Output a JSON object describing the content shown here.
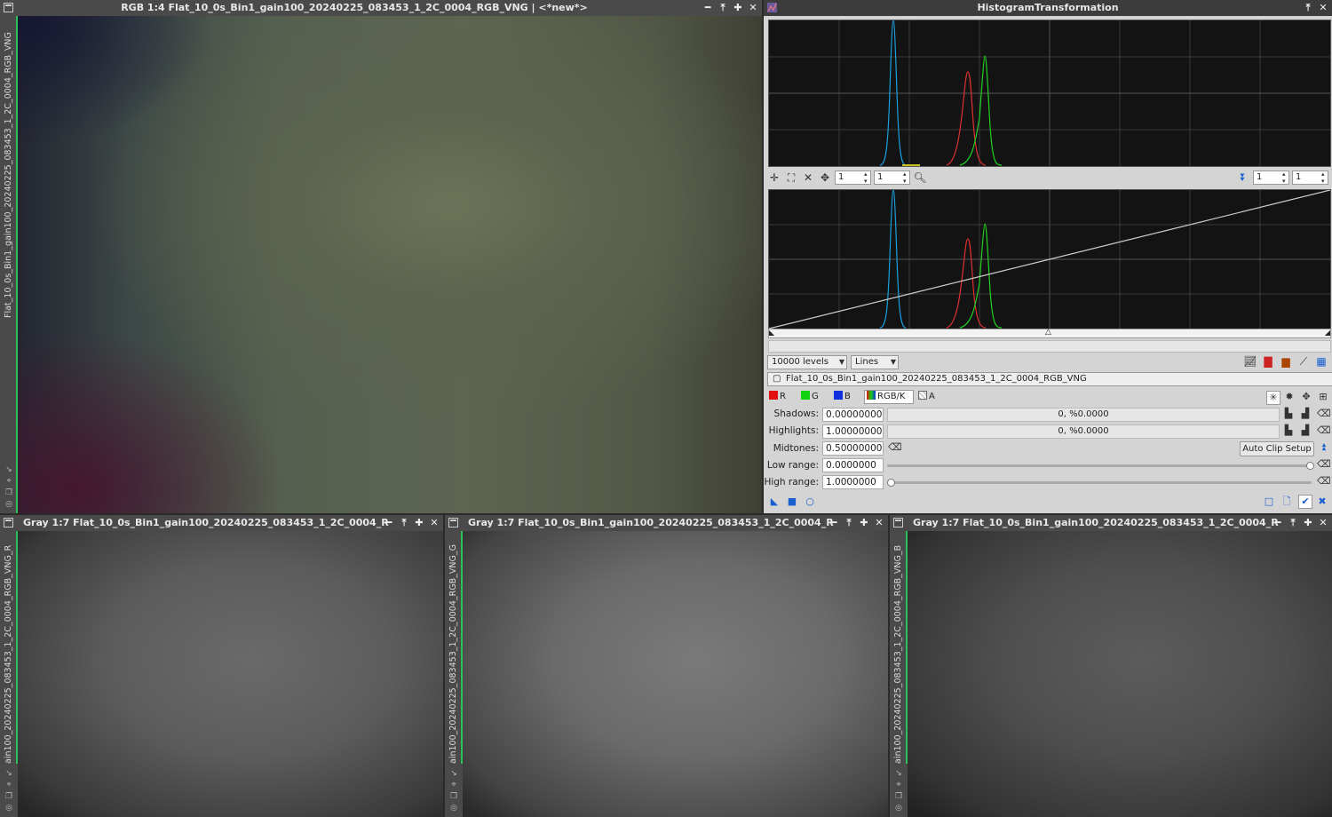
{
  "main_window": {
    "title": "RGB 1:4 Flat_10_0s_Bin1_gain100_20240225_083453_1_2C_0004_RGB_VNG | <*new*>",
    "side_label": "Flat_10_0s_Bin1_gain100_20240225_083453_1_2C_0004_RGB_VNG"
  },
  "histogram": {
    "title": "HistogramTransformation",
    "zoom_h": "1",
    "zoom_v": "1",
    "zoom2_h": "1",
    "zoom2_v": "1",
    "levels": "10000 levels",
    "graph_style": "Lines",
    "view": "Flat_10_0s_Bin1_gain100_20240225_083453_1_2C_0004_RGB_VNG",
    "channels": {
      "r": "R",
      "g": "G",
      "b": "B",
      "rgbk": "RGB/K",
      "a": "A"
    },
    "channel_colors": {
      "r": "#e01010",
      "g": "#10d010",
      "b": "#1030e0"
    },
    "shadows_label": "Shadows:",
    "shadows_value": "0.00000000",
    "shadows_readout": "0, %0.0000",
    "highlights_label": "Highlights:",
    "highlights_value": "1.00000000",
    "highlights_readout": "0, %0.0000",
    "midtones_label": "Midtones:",
    "midtones_value": "0.50000000",
    "auto_clip": "Auto Clip Setup",
    "low_range_label": "Low range:",
    "low_range_value": "0.0000000",
    "high_range_label": "High range:",
    "high_range_value": "1.0000000"
  },
  "gray_windows": [
    {
      "title": "Gray 1:7 Flat_10_0s_Bin1_gain100_20240225_083453_1_2C_0004_R...",
      "side_label": "ain100_20240225_083453_1_2C_0004_RGB_VNG_R"
    },
    {
      "title": "Gray 1:7 Flat_10_0s_Bin1_gain100_20240225_083453_1_2C_0004_R...",
      "side_label": "ain100_20240225_083453_1_2C_0004_RGB_VNG_G"
    },
    {
      "title": "Gray 1:7 Flat_10_0s_Bin1_gain100_20240225_083453_1_2C_0004_R...",
      "side_label": "ain100_20240225_083453_1_2C_0004_RGB_VNG_B"
    }
  ]
}
